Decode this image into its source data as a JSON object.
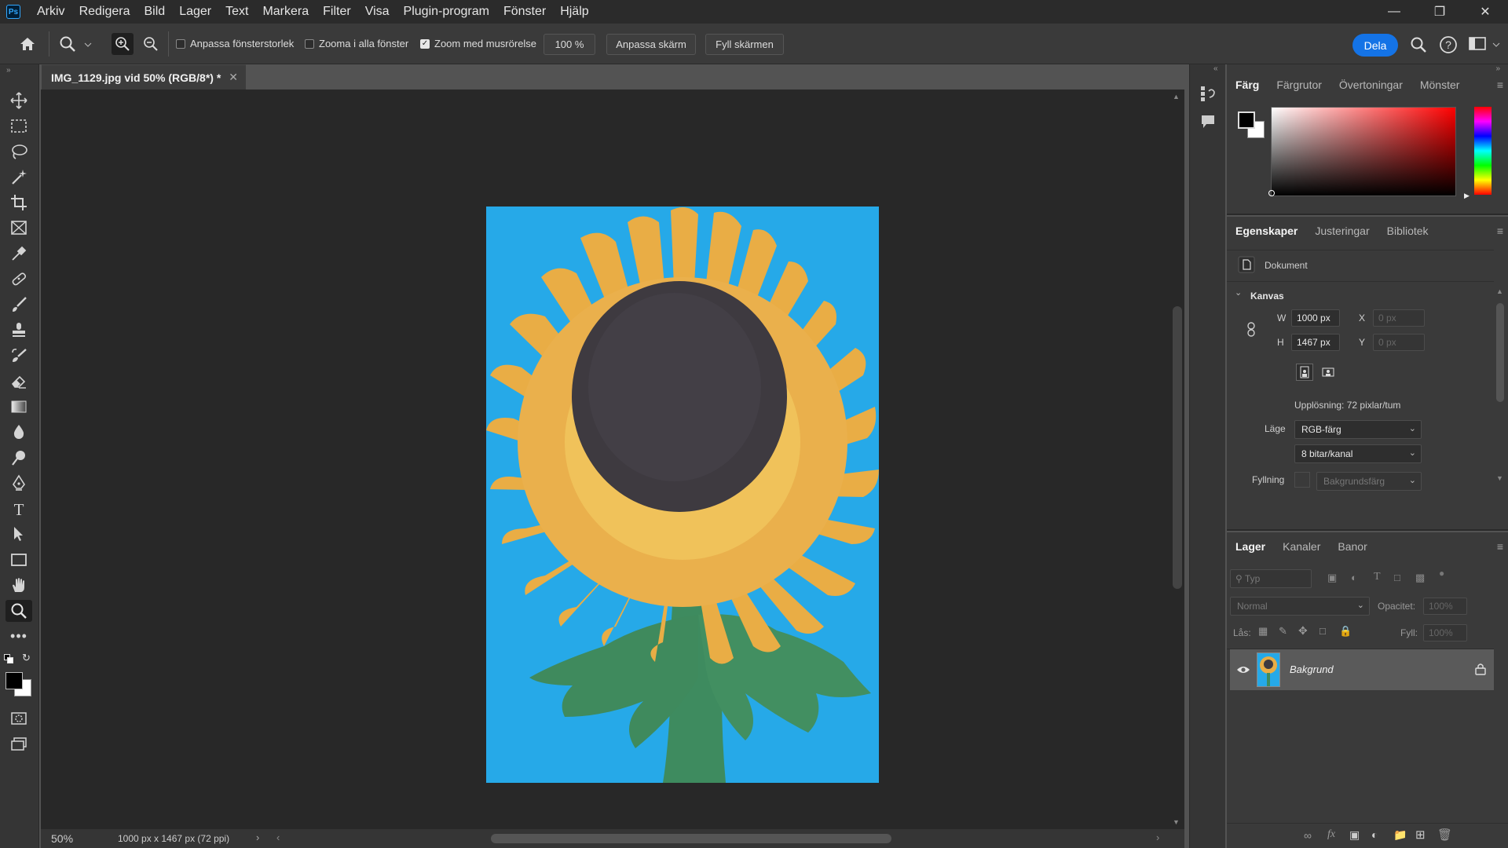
{
  "app": {
    "logo": "Ps"
  },
  "menu": [
    "Arkiv",
    "Redigera",
    "Bild",
    "Lager",
    "Text",
    "Markera",
    "Filter",
    "Visa",
    "Plugin-program",
    "Fönster",
    "Hjälp"
  ],
  "options": {
    "fit_window": "Anpassa fönsterstorlek",
    "zoom_all": "Zooma i alla fönster",
    "scrubby_zoom": "Zoom med musrörelse",
    "zoom_value": "100 %",
    "fit_screen": "Anpassa skärm",
    "fill_screen": "Fyll skärmen",
    "share": "Dela",
    "checked": {
      "fit_window": false,
      "zoom_all": false,
      "scrubby_zoom": true
    }
  },
  "document": {
    "tab_title": "IMG_1129.jpg vid 50% (RGB/8*) *",
    "zoom": "50%",
    "info": "1000 px x 1467 px (72 ppi)"
  },
  "color_panel": {
    "tabs": [
      "Färg",
      "Färgrutor",
      "Övertoningar",
      "Mönster"
    ],
    "hue_color": "#ff0000"
  },
  "properties": {
    "tabs": [
      "Egenskaper",
      "Justeringar",
      "Bibliotek"
    ],
    "doc_label": "Dokument",
    "section": "Kanvas",
    "w_label": "W",
    "w_value": "1000 px",
    "h_label": "H",
    "h_value": "1467 px",
    "x_label": "X",
    "x_value": "0 px",
    "y_label": "Y",
    "y_value": "0 px",
    "resolution": "Upplösning: 72 pixlar/tum",
    "mode_label": "Läge",
    "mode_value": "RGB-färg",
    "depth_value": "8 bitar/kanal",
    "fill_label": "Fyllning",
    "fill_value": "Bakgrundsfärg"
  },
  "layers": {
    "tabs": [
      "Lager",
      "Kanaler",
      "Banor"
    ],
    "search_placeholder": "Typ",
    "blend_mode": "Normal",
    "opacity_label": "Opacitet:",
    "opacity_value": "100%",
    "lock_label": "Lås:",
    "fill_label": "Fyll:",
    "fill_value": "100%",
    "items": [
      {
        "name": "Bakgrund"
      }
    ]
  },
  "colors": {
    "accent": "#1473e6",
    "sky": "#26a9e8",
    "petal": "#e9ad45",
    "center": "#3e3a40",
    "leaf": "#3e8b5f"
  }
}
